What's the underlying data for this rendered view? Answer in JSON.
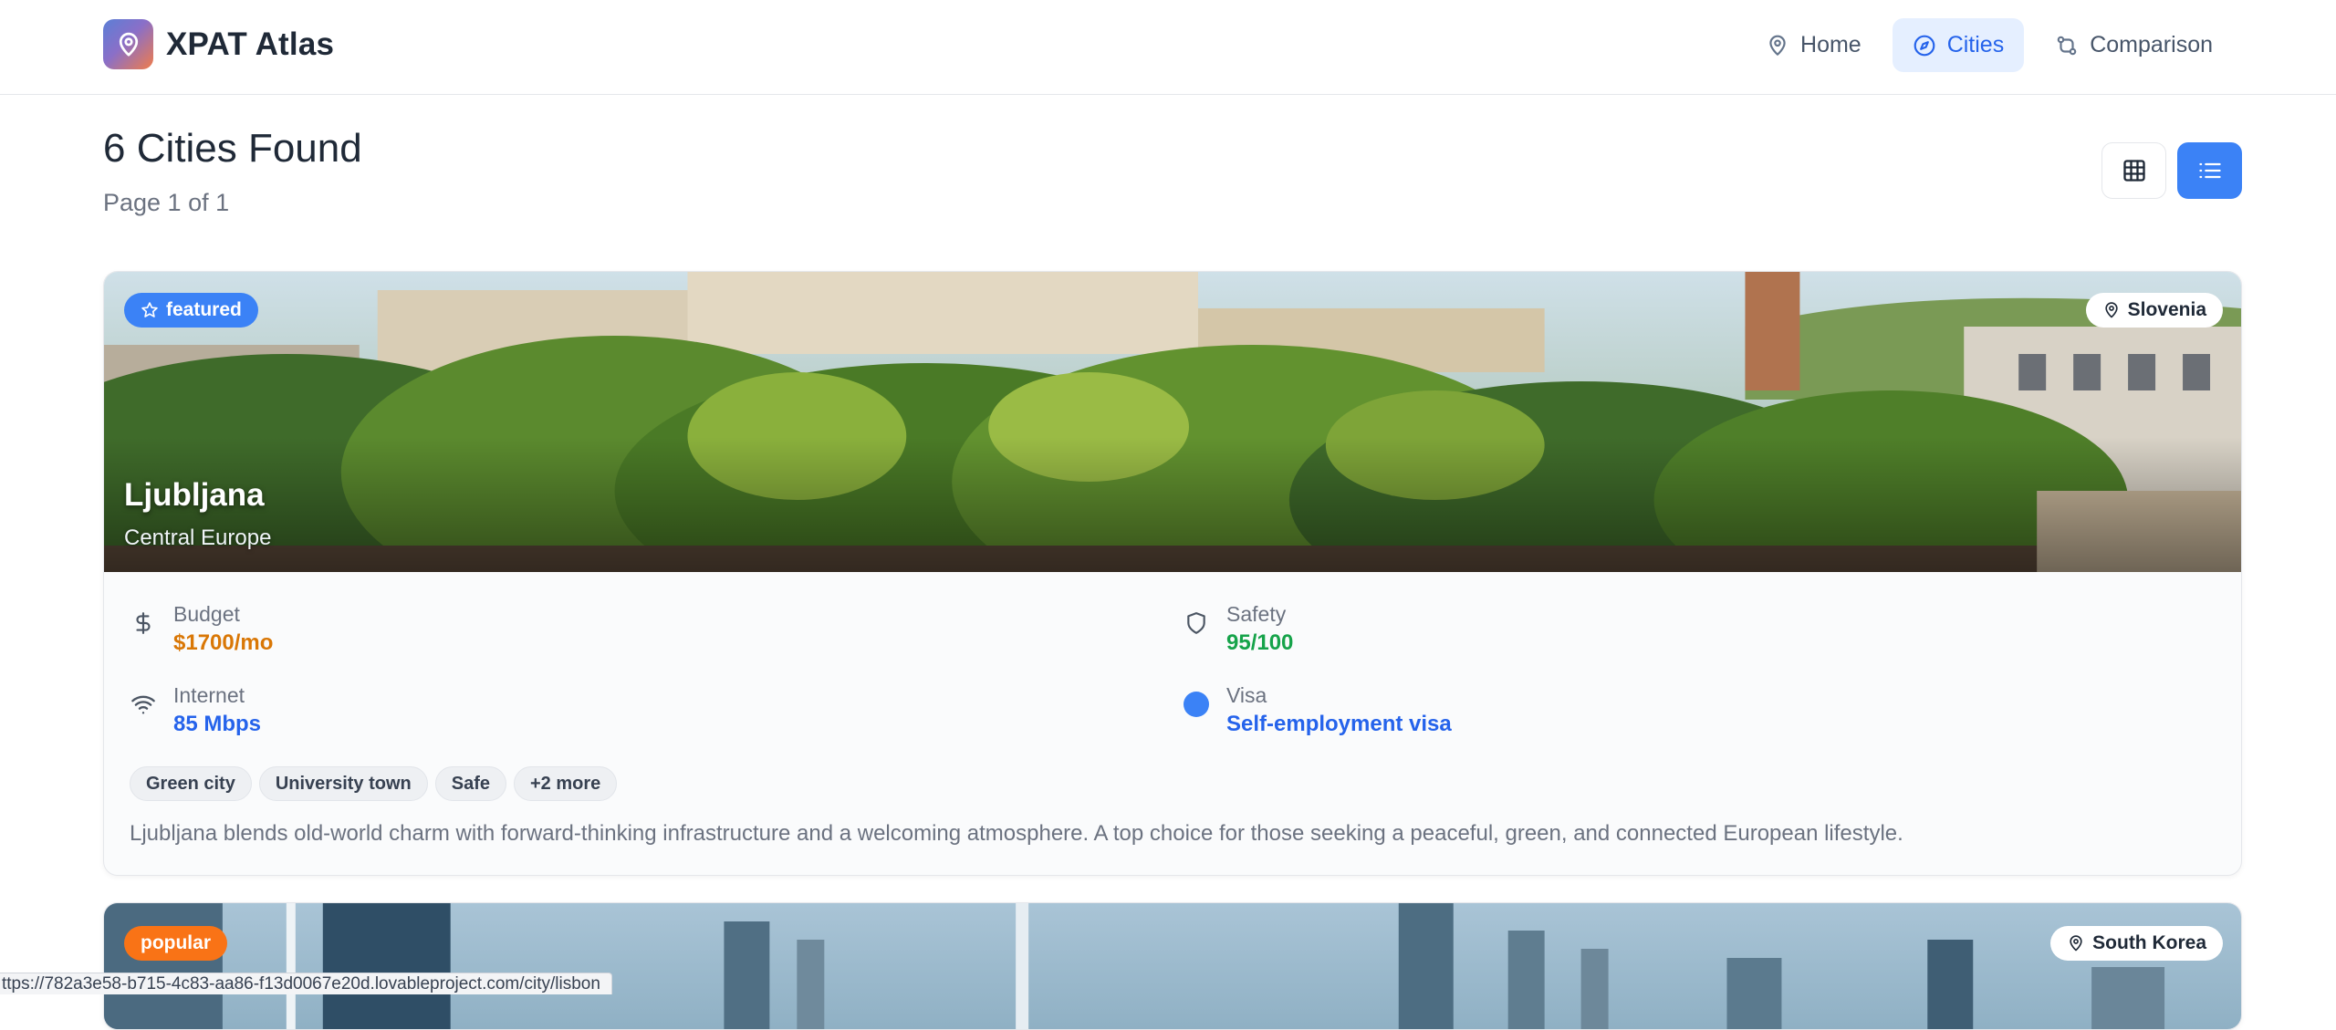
{
  "app": {
    "name": "XPAT Atlas"
  },
  "nav": [
    {
      "label": "Home",
      "icon": "map-pin-icon",
      "active": false
    },
    {
      "label": "Cities",
      "icon": "compass-icon",
      "active": true
    },
    {
      "label": "Comparison",
      "icon": "git-compare-icon",
      "active": false
    }
  ],
  "results": {
    "title": "6 Cities Found",
    "page_info": "Page 1 of 1"
  },
  "view_toggle": {
    "active": "list",
    "options": [
      "grid-icon",
      "list-icon"
    ]
  },
  "colors": {
    "accent": "#3b82f6",
    "budget": "#d97706",
    "safety": "#16a34a",
    "info": "#2563eb",
    "popular": "#f97316"
  },
  "cities": [
    {
      "badge": "featured",
      "country": "Slovenia",
      "name": "Ljubljana",
      "region": "Central Europe",
      "stats": {
        "budget_label": "Budget",
        "budget_value": "$1700/mo",
        "safety_label": "Safety",
        "safety_value": "95/100",
        "internet_label": "Internet",
        "internet_value": "85 Mbps",
        "visa_label": "Visa",
        "visa_value": "Self-employment visa"
      },
      "tags": [
        "Green city",
        "University town",
        "Safe",
        "+2 more"
      ],
      "description": "Ljubljana blends old-world charm with forward-thinking infrastructure and a welcoming atmosphere. A top choice for those seeking a peaceful, green, and connected European lifestyle."
    },
    {
      "badge": "popular",
      "country": "South Korea"
    }
  ],
  "status_bar": {
    "url": "ttps://782a3e58-b715-4c83-aa86-f13d0067e20d.lovableproject.com/city/lisbon"
  }
}
